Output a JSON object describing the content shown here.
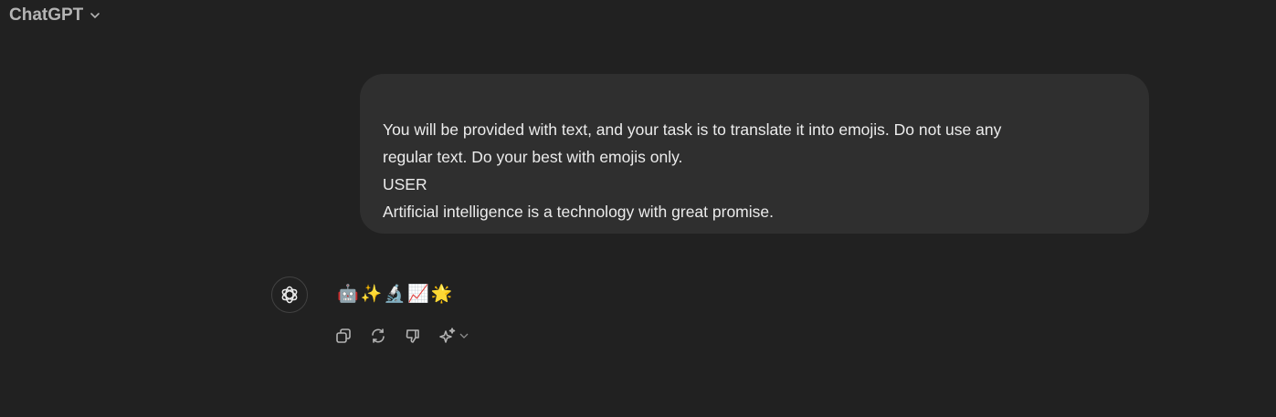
{
  "header": {
    "title": "ChatGPT"
  },
  "user_message": {
    "lines": [
      "You will be provided with text, and your task is to translate it into emojis. Do not use any",
      "regular text. Do your best with emojis only.",
      "USER",
      "Artificial intelligence is a technology with great promise."
    ]
  },
  "assistant_message": {
    "text": "🤖✨🔬📈🌟"
  },
  "actions": {
    "copy": "copy-icon",
    "regenerate": "regenerate-icon",
    "dislike": "thumbs-down-icon",
    "model": "sparkle-icon"
  }
}
